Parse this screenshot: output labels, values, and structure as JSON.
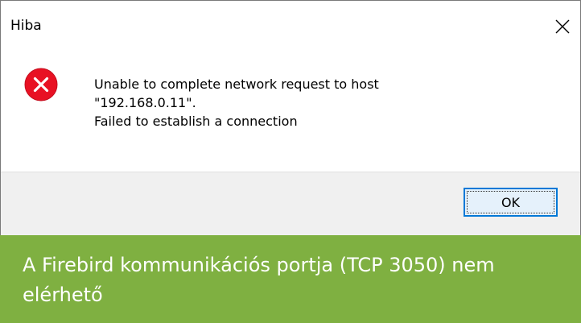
{
  "dialog": {
    "title": "Hiba",
    "close_icon": "close-icon",
    "error_icon": "error-icon",
    "message_lines": [
      "Unable to complete network request to host",
      "\"192.168.0.11\".",
      "Failed to establish a connection"
    ],
    "ok_label": "OK"
  },
  "caption": {
    "text": "A Firebird kommunikációs portja (TCP 3050) nem elérhető"
  },
  "colors": {
    "error_red": "#e81123",
    "caption_green": "#7fb041",
    "button_border": "#0078d7",
    "footer_bg": "#f0f0f0"
  }
}
